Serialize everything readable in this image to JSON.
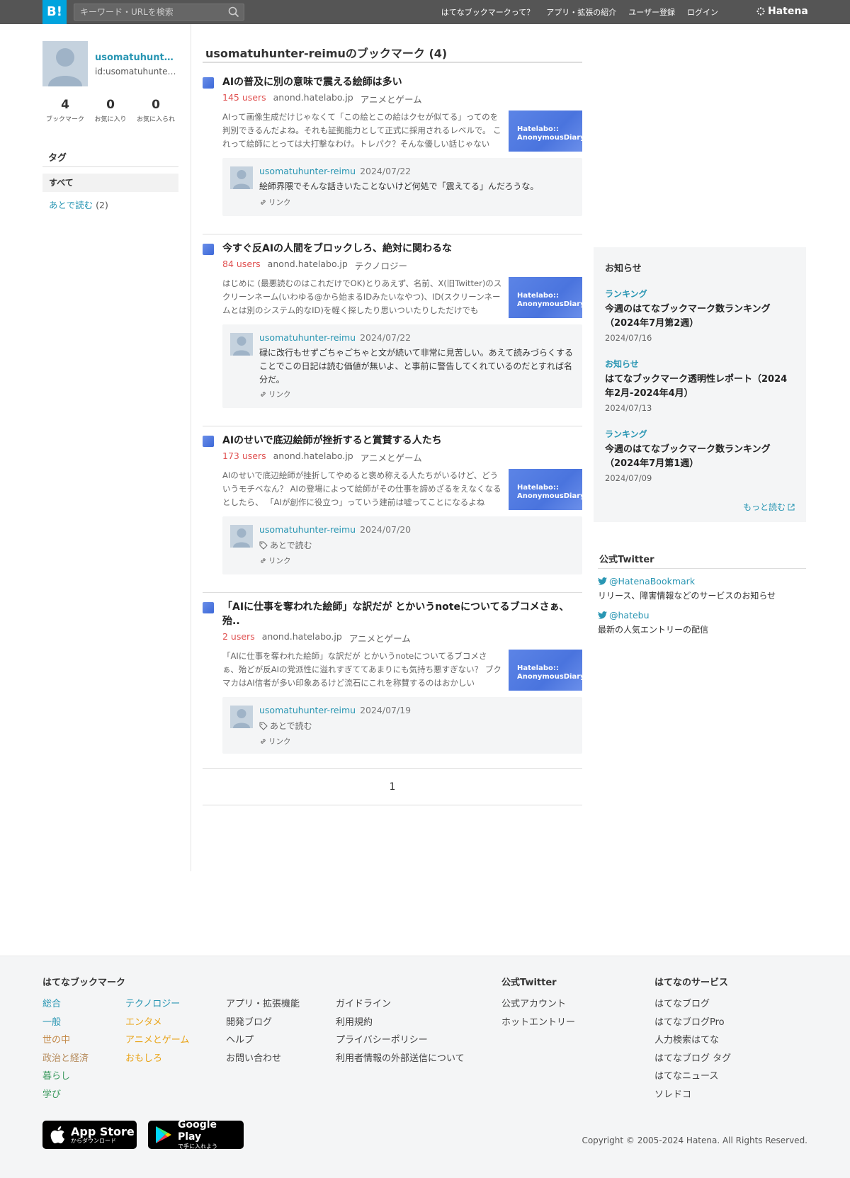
{
  "header": {
    "logo": "B!",
    "search_placeholder": "キーワード・URLを検索",
    "nav": [
      "はてなブックマークって？",
      "アプリ・拡張の紹介",
      "ユーザー登録",
      "ログイン"
    ],
    "brand": "Hatena"
  },
  "profile": {
    "name": "usomatuhunter-reimu",
    "id": "id:usomatuhunter-reimu",
    "stats": [
      {
        "num": "4",
        "label": "ブックマーク"
      },
      {
        "num": "0",
        "label": "お気に入り"
      },
      {
        "num": "0",
        "label": "お気に入られ"
      }
    ]
  },
  "tags": {
    "title": "タグ",
    "all": "すべて",
    "later": "あとで読む",
    "later_count": "(2)"
  },
  "main": {
    "title": "usomatuhunter-reimuのブックマーク (4)",
    "thumb_text": [
      "Hatelabo::",
      "AnonymousDiary"
    ],
    "entries": [
      {
        "title": "AIの普及に別の意味で震える絵師は多い",
        "users": "145 users",
        "domain": "anond.hatelabo.jp",
        "category": "アニメとゲーム",
        "summary": "AIって画像生成だけじゃなくて「この絵とこの絵はクセが似てる」ってのを判別できるんだよね。それも証拠能力として正式に採用されるレベルで。 これって絵師にとっては大打撃なわけ。トレパク？そんな優しい話じゃない",
        "user": "usomatuhunter-reimu",
        "date": "2024/07/22",
        "comment": "絵師界隈でそんな話きいたことないけど何処で「震えてる」んだろうな。",
        "tag": "",
        "link": "リンク"
      },
      {
        "title": "今すぐ反AIの人間をブロックしろ、絶対に関わるな",
        "users": "84 users",
        "domain": "anond.hatelabo.jp",
        "category": "テクノロジー",
        "summary": "はじめに (最悪読むのはこれだけでOK)とりあえず、名前、X(旧Twitter)のスクリーンネーム(いわゆる@から始まるIDみたいなやつ)、ID(スクリーンネームとは別のシステム的なID)を軽く探したり思いついたりしただけでも",
        "user": "usomatuhunter-reimu",
        "date": "2024/07/22",
        "comment": "碌に改行もせずごちゃごちゃと文が続いて非常に見苦しい。あえて読みづらくすることでこの日記は読む価値が無いよ、と事前に警告してくれているのだとすれば名分だ。",
        "tag": "",
        "link": "リンク"
      },
      {
        "title": "AIのせいで底辺絵師が挫折すると賞賛する人たち",
        "users": "173 users",
        "domain": "anond.hatelabo.jp",
        "category": "アニメとゲーム",
        "summary": "AIのせいで底辺絵師が挫折してやめると褒め称える人たちがいるけど、どういうモチベなん？ AIの登場によって絵師がその仕事を諦めざるをえなくなるとしたら、 「AIが創作に役立つ」っていう建前は嘘ってことになるよね",
        "user": "usomatuhunter-reimu",
        "date": "2024/07/20",
        "comment": "",
        "tag": "あとで読む",
        "link": "リンク"
      },
      {
        "title": "「AIに仕事を奪われた絵師」な訳だが とかいうnoteについてるブコメさぁ、殆..",
        "users": "2 users",
        "domain": "anond.hatelabo.jp",
        "category": "アニメとゲーム",
        "summary": "「AIに仕事を奪われた絵師」な訳だが とかいうnoteについてるブコメさぁ、殆どが反AIの党派性に溢れすぎててあまりにも気持ち悪すぎない？ ブクマカはAI信者が多い印象あるけど流石にこれを称賛するのはおかしい",
        "user": "usomatuhunter-reimu",
        "date": "2024/07/19",
        "comment": "",
        "tag": "あとで読む",
        "link": "リンク"
      }
    ],
    "page": "1"
  },
  "notice": {
    "title": "お知らせ",
    "items": [
      {
        "cat": "ランキング",
        "title": "今週のはてなブックマーク数ランキング（2024年7月第2週）",
        "date": "2024/07/16"
      },
      {
        "cat": "お知らせ",
        "title": "はてなブックマーク透明性レポート（2024年2月-2024年4月）",
        "date": "2024/07/13"
      },
      {
        "cat": "ランキング",
        "title": "今週のはてなブックマーク数ランキング（2024年7月第1週）",
        "date": "2024/07/09"
      }
    ],
    "more": "もっと読む"
  },
  "twitter": {
    "title": "公式Twitter",
    "items": [
      {
        "handle": "@HatenaBookmark",
        "desc": "リリース、障害情報などのサービスのお知らせ"
      },
      {
        "handle": "@hatebu",
        "desc": "最新の人気エントリーの配信"
      }
    ]
  },
  "footer": {
    "bookmark_heading": "はてなブックマーク",
    "categories_a": [
      "総合",
      "一般",
      "世の中",
      "政治と経済",
      "暮らし",
      "学び"
    ],
    "categories_a_colors": [
      "#2996b3",
      "#2996b3",
      "#c38a4a",
      "#b58a5a",
      "#3c9a5f",
      "#3c9a5f"
    ],
    "categories_b": [
      "テクノロジー",
      "エンタメ",
      "アニメとゲーム",
      "おもしろ"
    ],
    "categories_b_colors": [
      "#2996b3",
      "#e9a316",
      "#e9a316",
      "#e9a316"
    ],
    "links_a": [
      "アプリ・拡張機能",
      "開発ブログ",
      "ヘルプ",
      "お問い合わせ"
    ],
    "links_b": [
      "ガイドライン",
      "利用規約",
      "プライバシーポリシー",
      "利用者情報の外部送信について"
    ],
    "twitter_heading": "公式Twitter",
    "twitter_links": [
      "公式アカウント",
      "ホットエントリー"
    ],
    "services_heading": "はてなのサービス",
    "services": [
      "はてなブログ",
      "はてなブログPro",
      "人力検索はてな",
      "はてなブログ タグ",
      "はてなニュース",
      "ソレドコ"
    ],
    "appstore_main": "App Store",
    "appstore_sub": "からダウンロード",
    "googleplay_main": "Google Play",
    "googleplay_sub": "で手に入れよう",
    "copyright": "Copyright © 2005-2024 Hatena. All Rights Reserved."
  }
}
